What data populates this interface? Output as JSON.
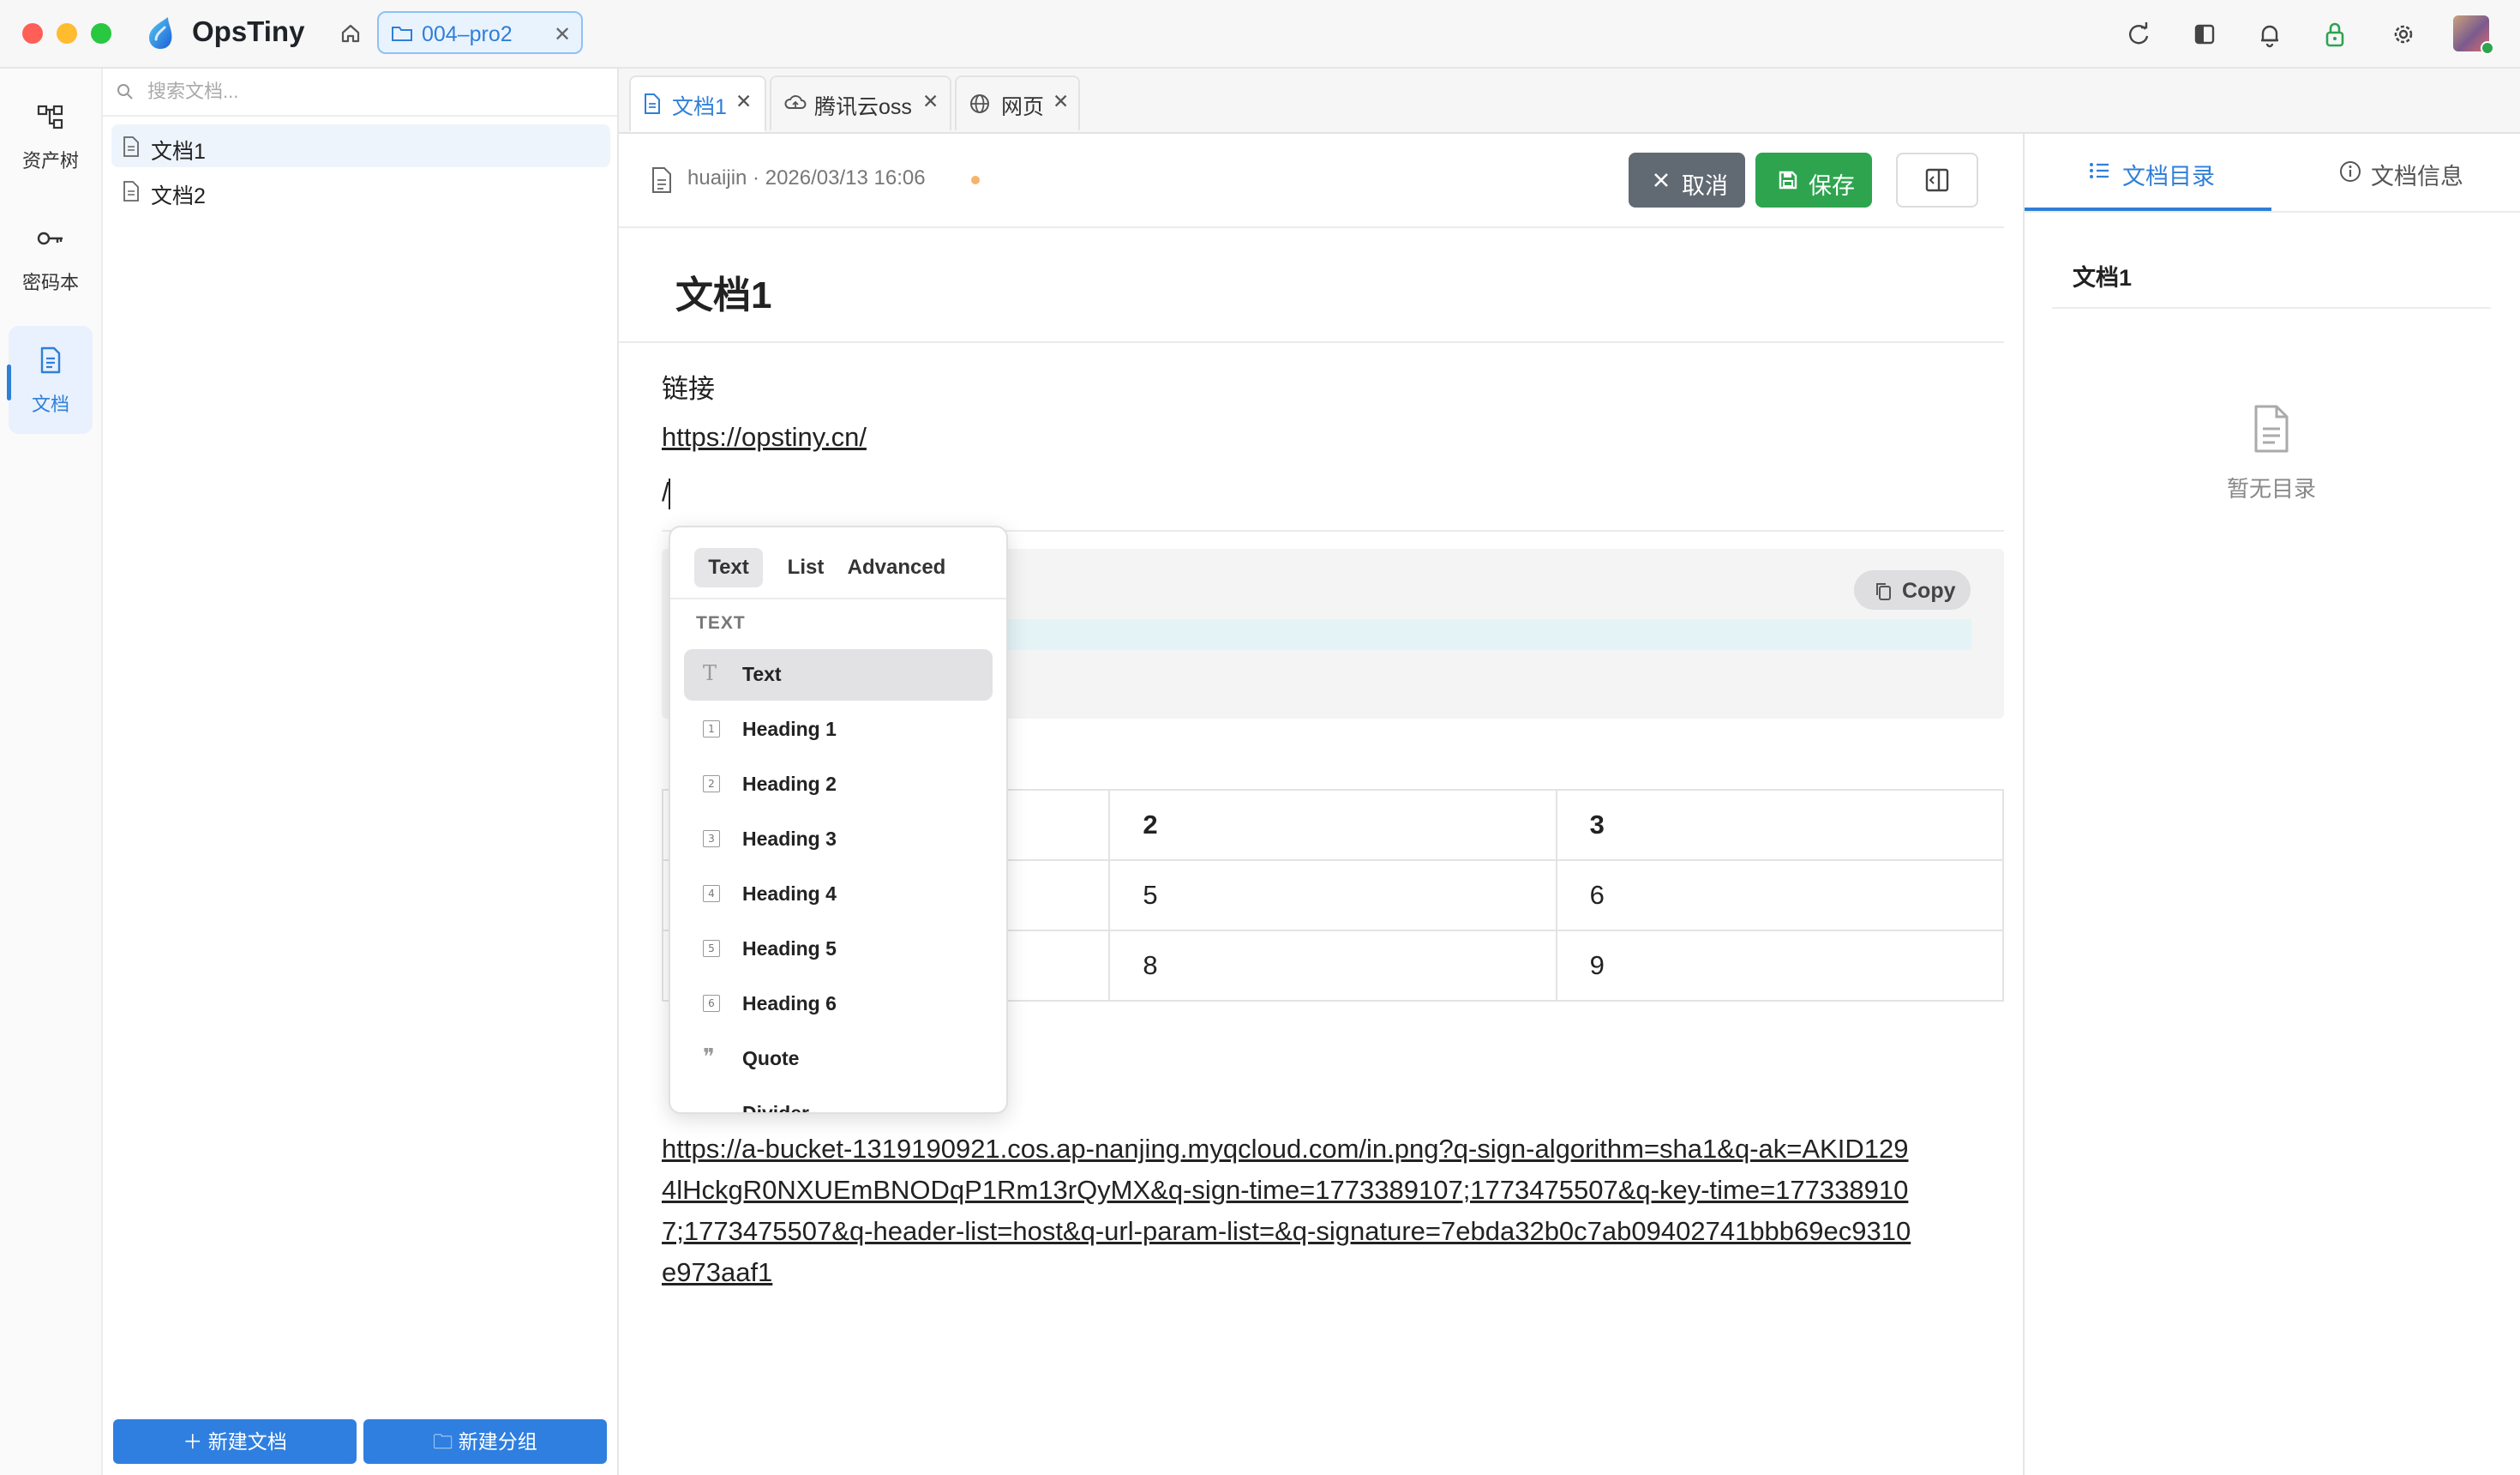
{
  "window": {
    "traffic_lights": [
      "#ff5f57",
      "#febc2e",
      "#28c840"
    ],
    "app_title": "OpsTiny",
    "path_chip": "004–pro2",
    "accent": "#2f7fd7"
  },
  "rail": {
    "items": [
      {
        "label": "资产树",
        "icon": "asset-tree-icon"
      },
      {
        "label": "密码本",
        "icon": "key-icon"
      },
      {
        "label": "文档",
        "icon": "document-icon",
        "active": true
      }
    ]
  },
  "doclist": {
    "search_placeholder": "搜索文档...",
    "items": [
      {
        "label": "文档1",
        "selected": true
      },
      {
        "label": "文档2"
      }
    ],
    "new_doc": "新建文档",
    "new_group": "新建分组"
  },
  "tabs": [
    {
      "label": "文档1",
      "icon": "document-icon",
      "active": true
    },
    {
      "label": "腾讯云oss",
      "icon": "cloud-icon"
    },
    {
      "label": "网页",
      "icon": "globe-icon"
    }
  ],
  "editor": {
    "meta": "huaijin · 2026/03/13 16:06",
    "cancel": "取消",
    "save": "保存",
    "title": "文档1",
    "para_link_label": "链接",
    "link1": "https://opstiny.cn/",
    "slash_line": "/",
    "copy": "Copy",
    "table": [
      [
        "",
        "2",
        "3"
      ],
      [
        "",
        "5",
        "6"
      ],
      [
        "",
        "8",
        "9"
      ]
    ],
    "long_link": "https://a-bucket-1319190921.cos.ap-nanjing.myqcloud.com/in.png?q-sign-algorithm=sha1&q-ak=AKID1294lHckgR0NXUEmBNODqP1Rm13rQyMX&q-sign-time=1773389107;1773475507&q-key-time=1773389107;1773475507&q-header-list=host&q-url-param-list=&q-signature=7ebda32b0c7ab09402741bbb69ec9310e973aaf1"
  },
  "slash_menu": {
    "tabs": [
      "Text",
      "List",
      "Advanced"
    ],
    "active_tab": "Text",
    "section": "TEXT",
    "items": [
      {
        "label": "Text",
        "icon": "text-icon",
        "highlighted": true
      },
      {
        "label": "Heading 1",
        "icon": "heading-1-icon",
        "num": "1"
      },
      {
        "label": "Heading 2",
        "icon": "heading-2-icon",
        "num": "2"
      },
      {
        "label": "Heading 3",
        "icon": "heading-3-icon",
        "num": "3"
      },
      {
        "label": "Heading 4",
        "icon": "heading-4-icon",
        "num": "4"
      },
      {
        "label": "Heading 5",
        "icon": "heading-5-icon",
        "num": "5"
      },
      {
        "label": "Heading 6",
        "icon": "heading-6-icon",
        "num": "6"
      },
      {
        "label": "Quote",
        "icon": "quote-icon",
        "glyph": "❞"
      },
      {
        "label": "Divider",
        "icon": "divider-icon"
      }
    ]
  },
  "right_panel": {
    "tab_toc": "文档目录",
    "tab_info": "文档信息",
    "toc_doc": "文档1",
    "empty_text": "暂无目录"
  }
}
